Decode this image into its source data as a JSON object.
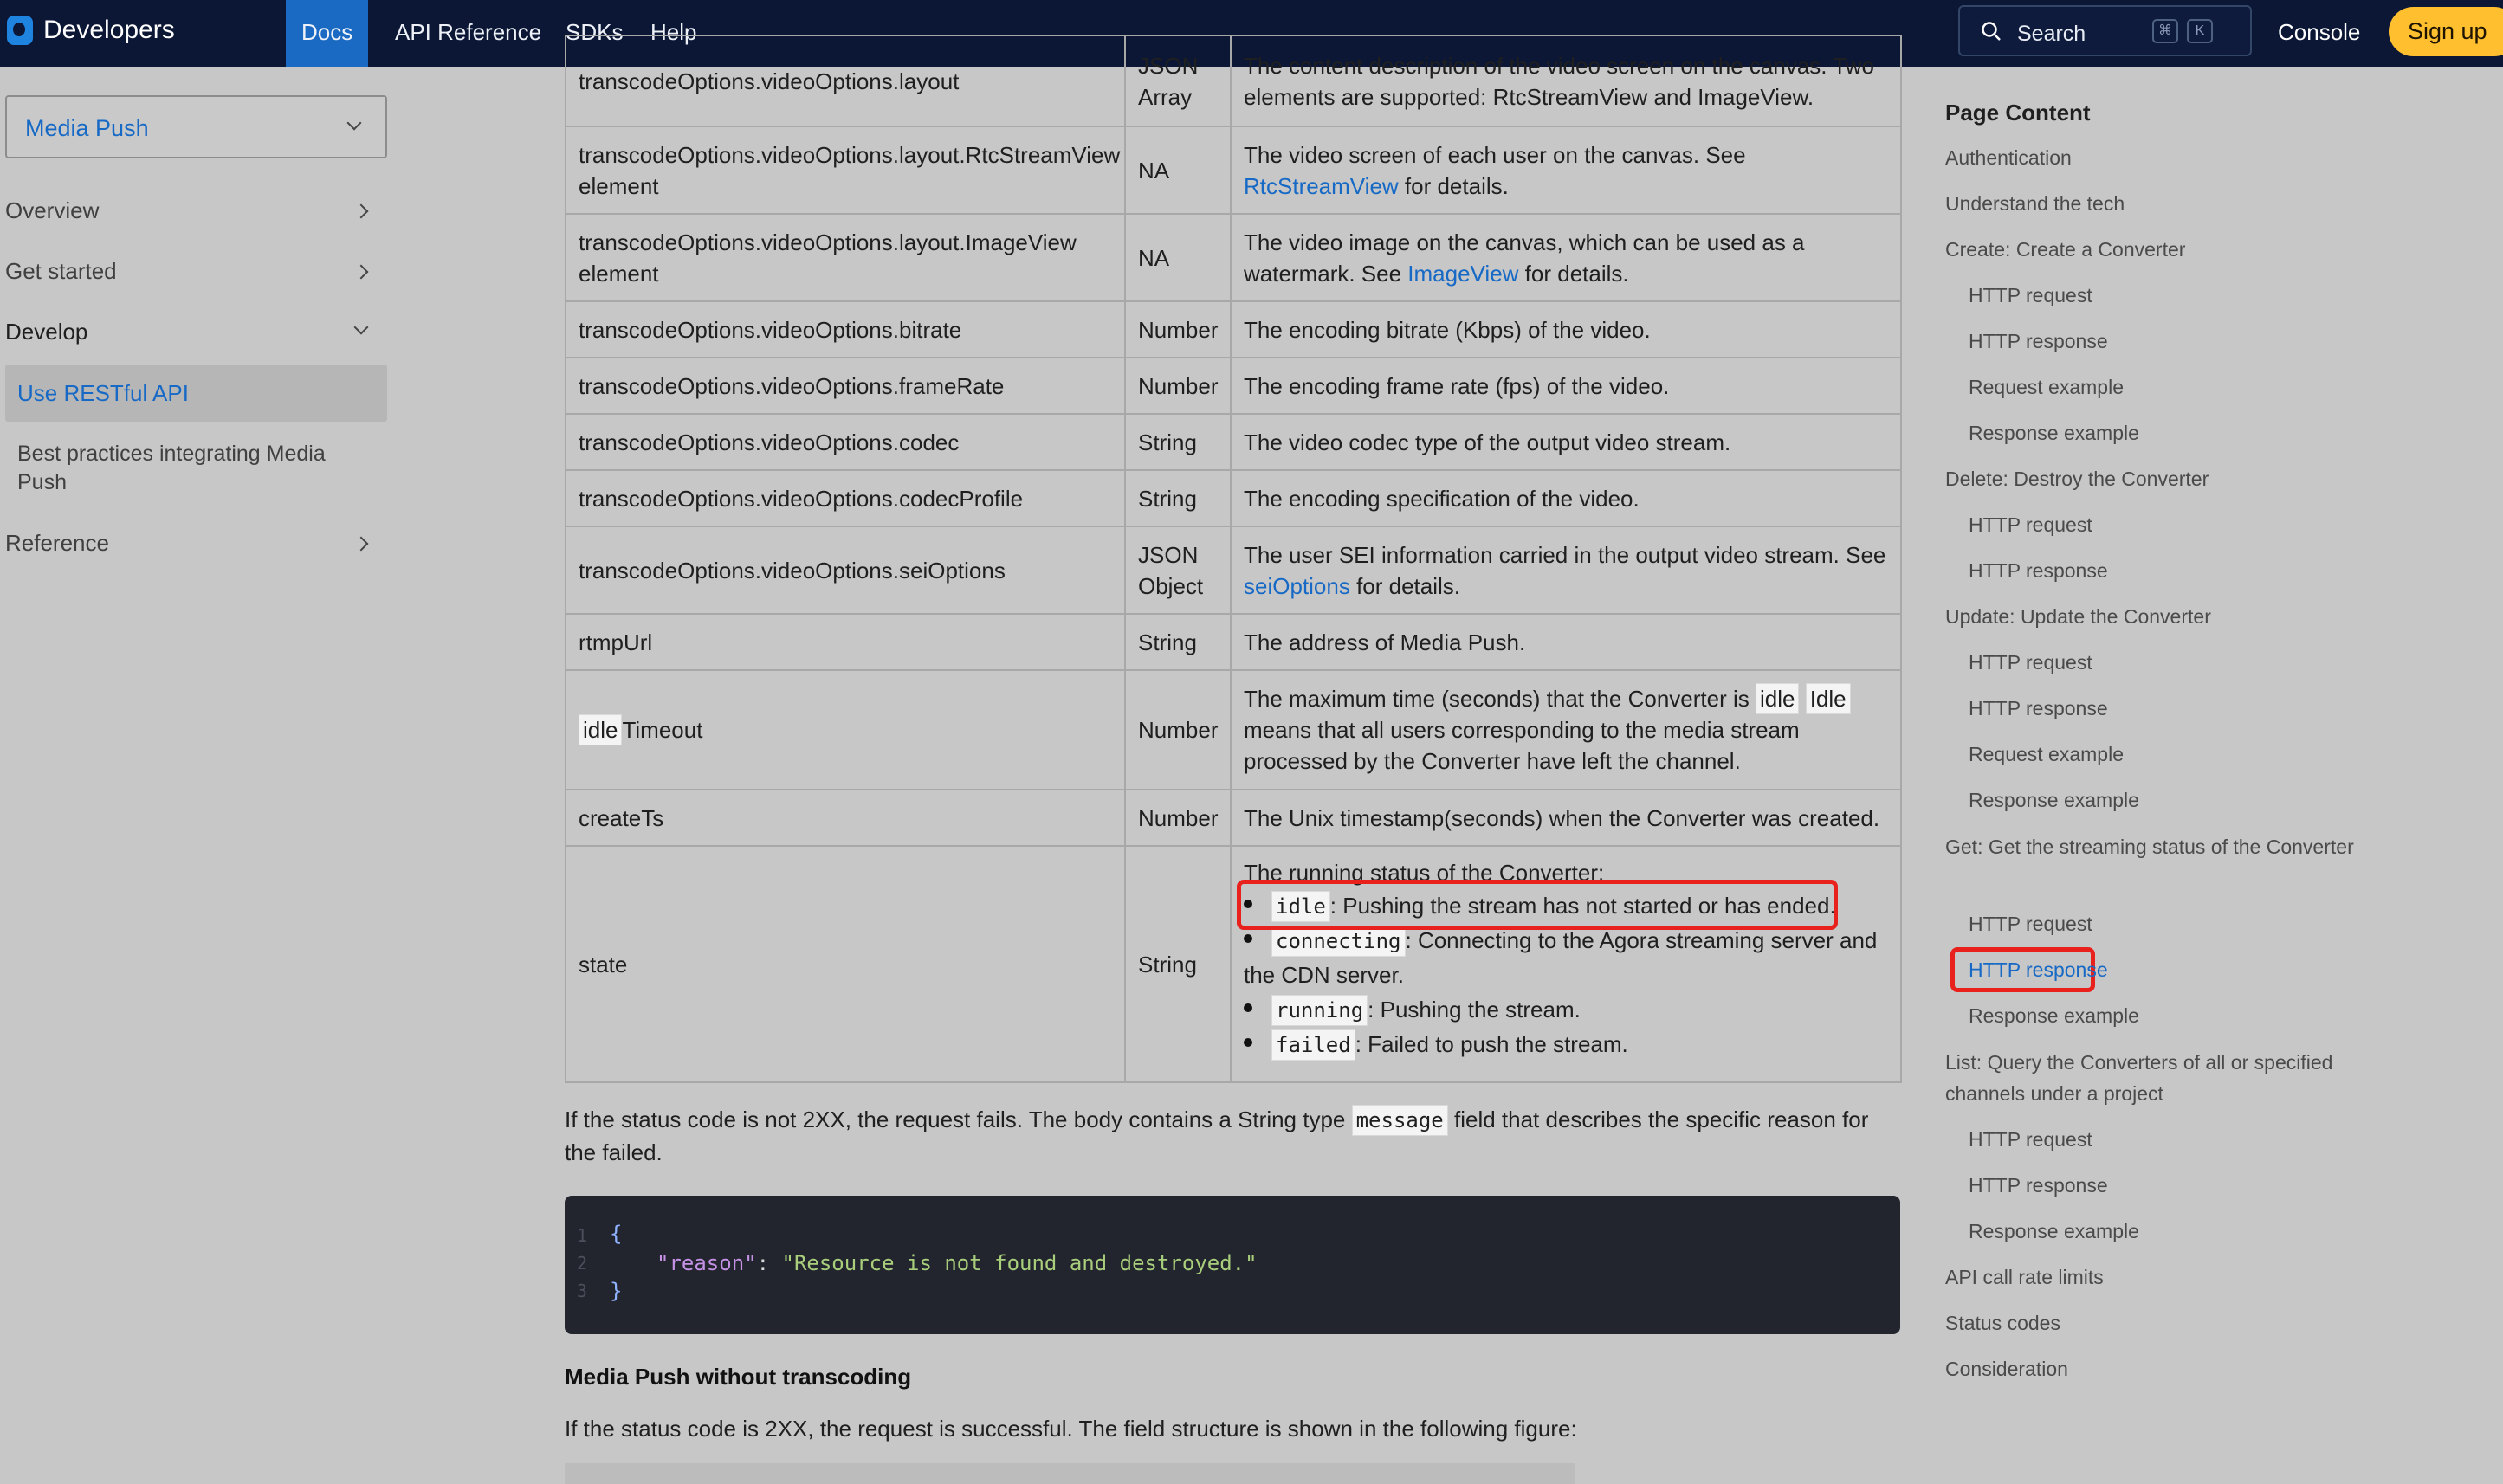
{
  "topnav": {
    "brand": "Developers",
    "links": {
      "docs": "Docs",
      "api_reference": "API Reference",
      "sdks": "SDKs",
      "help": "Help"
    },
    "search": {
      "label": "Search",
      "shortcut_mod": "⌘",
      "shortcut_key": "K"
    },
    "console": "Console",
    "signup": "Sign up"
  },
  "sidebar": {
    "product": "Media Push",
    "items": {
      "overview": "Overview",
      "get_started": "Get started",
      "develop": "Develop",
      "reference": "Reference"
    },
    "develop_children": {
      "active": "Use RESTful API",
      "best_practices": "Best practices integrating Media Push"
    }
  },
  "table": {
    "rows": [
      {
        "field": "transcodeOptions.videoOptions.layout",
        "type": "JSON Array",
        "desc": "The content description of the video screen on the canvas. Two elements are supported: RtcStreamView and ImageView."
      },
      {
        "field": "transcodeOptions.videoOptions.layout.RtcStreamView element",
        "type": "NA",
        "desc_pre": "The video screen of each user on the canvas. See ",
        "desc_link": "RtcStreamView",
        "desc_post": " for details."
      },
      {
        "field": "transcodeOptions.videoOptions.layout.ImageView element",
        "type": "NA",
        "desc_pre": "The video image on the canvas, which can be used as a watermark. See ",
        "desc_link": "ImageView",
        "desc_post": " for details."
      },
      {
        "field": "transcodeOptions.videoOptions.bitrate",
        "type": "Number",
        "desc": "The encoding bitrate (Kbps) of the video."
      },
      {
        "field": "transcodeOptions.videoOptions.frameRate",
        "type": "Number",
        "desc": "The encoding frame rate (fps) of the video."
      },
      {
        "field": "transcodeOptions.videoOptions.codec",
        "type": "String",
        "desc": "The video codec type of the output video stream."
      },
      {
        "field": "transcodeOptions.videoOptions.codecProfile",
        "type": "String",
        "desc": "The encoding specification of the video."
      },
      {
        "field": "transcodeOptions.videoOptions.seiOptions",
        "type": "JSON Object",
        "desc_pre": "The user SEI information carried in the output video stream. See ",
        "desc_link": "seiOptions",
        "desc_post": " for details."
      },
      {
        "field": "rtmpUrl",
        "type": "String",
        "desc": "The address of Media Push."
      },
      {
        "field_chip": "idle",
        "field_rest": "Timeout",
        "type": "Number",
        "desc_pre": "The maximum time (seconds) that the Converter is ",
        "chip1": "idle",
        "chip2": "Idle",
        "desc_post": " means that all users corresponding to the media stream processed by the Converter have left the channel."
      },
      {
        "field": "createTs",
        "type": "Number",
        "desc": "The Unix timestamp(seconds) when the Converter was created."
      },
      {
        "field": "state",
        "type": "String",
        "desc": "The running status of the Converter:",
        "bullets": [
          {
            "code": "idle",
            "text": ": Pushing the stream has not started or has ended."
          },
          {
            "code": "connecting",
            "text": ": Connecting to the Agora streaming server and the CDN server."
          },
          {
            "code": "running",
            "text": ": Pushing the stream."
          },
          {
            "code": "failed",
            "text": ": Failed to push the stream."
          }
        ]
      }
    ]
  },
  "content": {
    "fail_para_pre": "If the status code is not 2XX, the request fails. The body contains a String type ",
    "fail_para_code": "message",
    "fail_para_post": " field that describes the specific reason for the failed.",
    "code": {
      "line_numbers": [
        "1",
        "2",
        "3"
      ],
      "open": "{",
      "key": "\"reason\"",
      "colon": ": ",
      "value": "\"Resource is not found and destroyed.\"",
      "close": "}"
    },
    "heading": "Media Push without transcoding",
    "success_para": "If the status code is 2XX, the request is successful. The field structure is shown in the following figure:"
  },
  "toc": {
    "title": "Page Content",
    "items": [
      {
        "label": "Authentication",
        "level": 1
      },
      {
        "label": "Understand the tech",
        "level": 1
      },
      {
        "label": "Create: Create a Converter",
        "level": 1
      },
      {
        "label": "HTTP request",
        "level": 2
      },
      {
        "label": "HTTP response",
        "level": 2
      },
      {
        "label": "Request example",
        "level": 2
      },
      {
        "label": "Response example",
        "level": 2
      },
      {
        "label": "Delete: Destroy the Converter",
        "level": 1
      },
      {
        "label": "HTTP request",
        "level": 2
      },
      {
        "label": "HTTP response",
        "level": 2
      },
      {
        "label": "Update: Update the Converter",
        "level": 1
      },
      {
        "label": "HTTP request",
        "level": 2
      },
      {
        "label": "HTTP response",
        "level": 2
      },
      {
        "label": "Request example",
        "level": 2
      },
      {
        "label": "Response example",
        "level": 2
      },
      {
        "label": "Get: Get the streaming status of the Converter",
        "level": 1
      },
      {
        "label": "HTTP request",
        "level": 2
      },
      {
        "label": "HTTP response",
        "level": 2,
        "active": true
      },
      {
        "label": "Response example",
        "level": 2
      },
      {
        "label": "List: Query the Converters of all or specified channels under a project",
        "level": 1
      },
      {
        "label": "HTTP request",
        "level": 2
      },
      {
        "label": "HTTP response",
        "level": 2
      },
      {
        "label": "Response example",
        "level": 2
      },
      {
        "label": "API call rate limits",
        "level": 1
      },
      {
        "label": "Status codes",
        "level": 1
      },
      {
        "label": "Consideration",
        "level": 1
      }
    ]
  },
  "colors": {
    "nav_bg": "#0b1735",
    "accent": "#1769c6",
    "signup": "#ffbf2e",
    "highlight": "#e8211c"
  }
}
